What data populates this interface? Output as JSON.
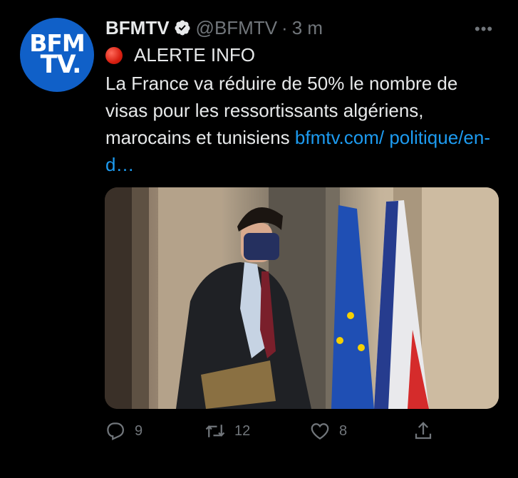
{
  "tweet": {
    "avatar": {
      "line1": "BFM",
      "line2": "TV."
    },
    "author_name": "BFMTV",
    "author_handle": "@BFMTV",
    "separator": "·",
    "time": "3 m",
    "more_label": "•••",
    "alert_text": "ALERTE INFO",
    "body_text": "La France va réduire de 50% le nombre de visas pour les ressortissants algériens, marocains et tunisiens ",
    "link_text": "bfmtv.com/ politique/en-d…"
  },
  "actions": {
    "reply_count": "9",
    "retweet_count": "12",
    "like_count": "8"
  },
  "colors": {
    "background": "#000000",
    "text": "#e7e9ea",
    "muted": "#71767b",
    "link": "#1d9bf0",
    "avatar": "#1060c8"
  },
  "icons": [
    "verified-badge-icon",
    "red-circle-icon",
    "more-icon",
    "reply-icon",
    "retweet-icon",
    "like-icon",
    "share-icon"
  ]
}
